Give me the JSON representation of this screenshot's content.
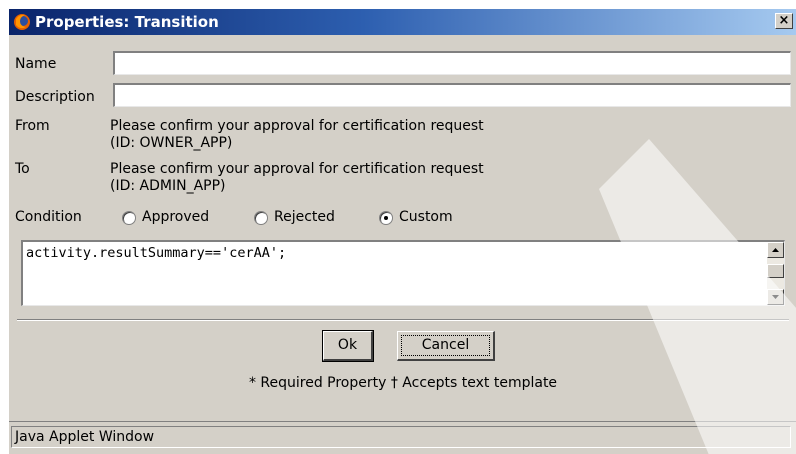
{
  "window": {
    "title": "Properties: Transition",
    "icon": "firefox-logo-icon",
    "close_glyph": "×"
  },
  "form": {
    "name_label": "Name",
    "name_value": "",
    "description_label": "Description",
    "description_value": "",
    "from_label": "From",
    "from_line1": "Please confirm your approval for certification request",
    "from_line2": "(ID: OWNER_APP)",
    "to_label": "To",
    "to_line1": "Please confirm your approval for certification request",
    "to_line2": "(ID: ADMIN_APP)",
    "condition_label": "Condition",
    "condition_options": [
      {
        "label": "Approved",
        "checked": false
      },
      {
        "label": "Rejected",
        "checked": false
      },
      {
        "label": "Custom",
        "checked": true
      }
    ],
    "condition_expression": "activity.resultSummary=='cerAA';"
  },
  "buttons": {
    "ok": "Ok",
    "cancel": "Cancel"
  },
  "footnote": "* Required Property  † Accepts text template",
  "status": {
    "text": "Java Applet Window"
  },
  "colors": {
    "dialog_bg": "#d4d0c8",
    "title_gradient_start": "#0a246a",
    "title_gradient_end": "#a6caf0"
  }
}
